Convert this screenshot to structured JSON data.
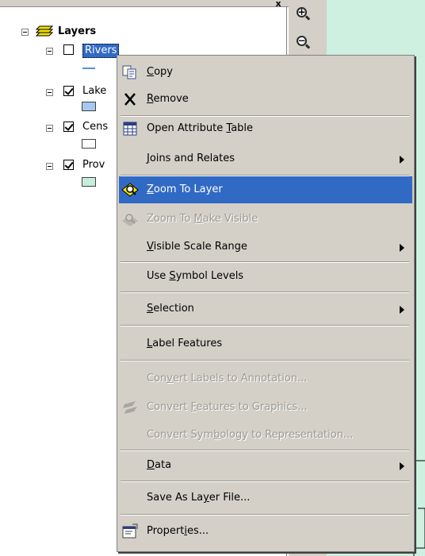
{
  "toc": {
    "title": "Layers",
    "layers": [
      {
        "name": "Rivers",
        "checked": false,
        "selected": true,
        "symbol": "line",
        "color": "#5a8fd8"
      },
      {
        "name": "Lake",
        "checked": true,
        "selected": false,
        "symbol": "fill",
        "color": "#a6c8f0"
      },
      {
        "name": "Cens",
        "checked": true,
        "selected": false,
        "symbol": "fill",
        "color": "#ffffff"
      },
      {
        "name": "Prov",
        "checked": true,
        "selected": false,
        "symbol": "fill",
        "color": "#c6eedb"
      }
    ]
  },
  "tools": {
    "close_glyph": "x",
    "zoom_in_icon": "zoom-in-icon",
    "zoom_out_icon": "zoom-out-icon"
  },
  "context_menu": {
    "items": [
      {
        "label": "Copy",
        "accel": "C",
        "icon": "copy-icon",
        "enabled": true,
        "submenu": false
      },
      {
        "label": "Remove",
        "accel": "R",
        "icon": "remove-x-icon",
        "enabled": true,
        "submenu": false
      },
      {
        "label": "Open Attribute Table",
        "accel": "T",
        "icon": "table-icon",
        "enabled": true,
        "submenu": false
      },
      {
        "label": "Joins and Relates",
        "accel": "J",
        "icon": "",
        "enabled": true,
        "submenu": true
      },
      {
        "label": "Zoom To Layer",
        "accel": "Z",
        "icon": "zoom-to-layer-icon",
        "enabled": true,
        "submenu": false,
        "highlighted": true
      },
      {
        "label": "Zoom To Make Visible",
        "accel": "M",
        "icon": "zoom-to-make-visible-icon",
        "enabled": false,
        "submenu": false
      },
      {
        "label": "Visible Scale Range",
        "accel": "V",
        "icon": "",
        "enabled": true,
        "submenu": true
      },
      {
        "label": "Use Symbol Levels",
        "accel": "g",
        "icon": "",
        "enabled": true,
        "submenu": false
      },
      {
        "label": "Selection",
        "accel": "S",
        "icon": "",
        "enabled": true,
        "submenu": true
      },
      {
        "label": "Label Features",
        "accel": "L",
        "icon": "",
        "enabled": true,
        "submenu": false
      },
      {
        "label": "Convert Labels to Annotation...",
        "accel": "v",
        "icon": "",
        "enabled": false,
        "submenu": false
      },
      {
        "label": "Convert Features to Graphics...",
        "accel": "F",
        "icon": "convert-graphics-icon",
        "enabled": false,
        "submenu": false
      },
      {
        "label": "Convert Symbology to Representation...",
        "accel": "b",
        "icon": "",
        "enabled": false,
        "submenu": false
      },
      {
        "label": "Data",
        "accel": "D",
        "icon": "",
        "enabled": true,
        "submenu": true
      },
      {
        "label": "Save As Layer File...",
        "accel": "y",
        "icon": "",
        "enabled": true,
        "submenu": false
      },
      {
        "label": "Properties...",
        "accel": "i",
        "icon": "properties-icon",
        "enabled": true,
        "submenu": false
      }
    ]
  },
  "colors": {
    "menu_bg": "#d4d0c8",
    "highlight": "#316ac5",
    "map_bg": "#cdf0e0",
    "disabled_text": "#9c9a92"
  }
}
